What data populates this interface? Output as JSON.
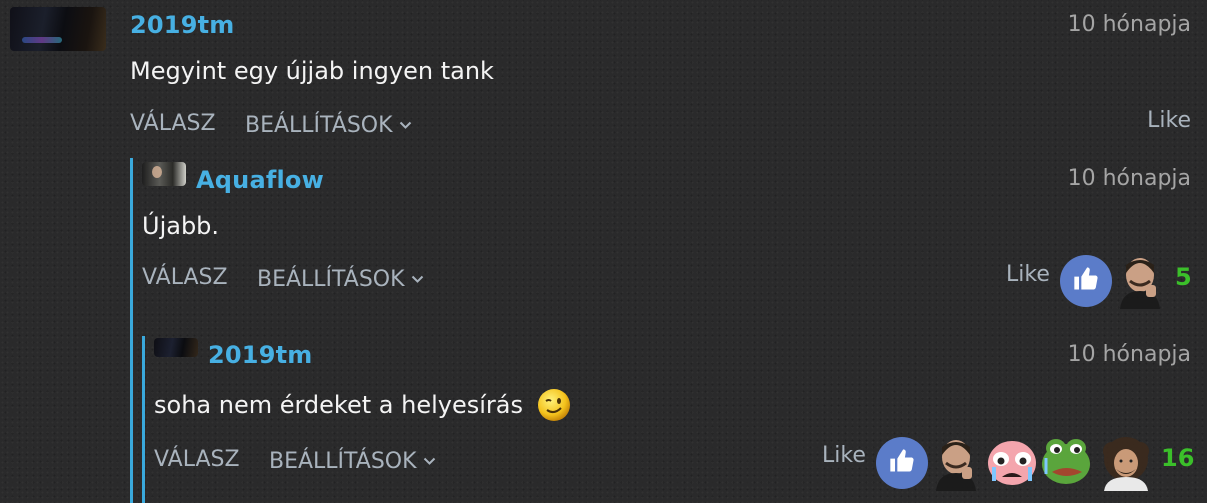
{
  "comments": [
    {
      "username": "2019tm",
      "time": "10 hónapja",
      "text": "Megyint egy újjab ingyen tank",
      "reply_label": "VÁLASZ",
      "settings_label": "BEÁLLÍTÁSOK",
      "like_label": "Like"
    },
    {
      "username": "Aquaflow",
      "time": "10 hónapja",
      "text": "Újabb.",
      "reply_label": "VÁLASZ",
      "settings_label": "BEÁLLÍTÁSOK",
      "like_label": "Like",
      "reaction_count": "5"
    },
    {
      "username": "2019tm",
      "time": "10 hónapja",
      "text": "soha nem érdeket a helyesírás",
      "reply_label": "VÁLASZ",
      "settings_label": "BEÁLLÍTÁSOK",
      "like_label": "Like",
      "reaction_count": "16"
    }
  ],
  "icons": {
    "chevron": "chevron-down-icon",
    "thumbs_up": "thumbs-up-icon",
    "wink": "wink-emoji-icon"
  },
  "colors": {
    "username": "#47b0e3",
    "thread_line": "#3aa9dc",
    "count": "#3bbf2a",
    "like_circle": "#5b7cc9"
  }
}
